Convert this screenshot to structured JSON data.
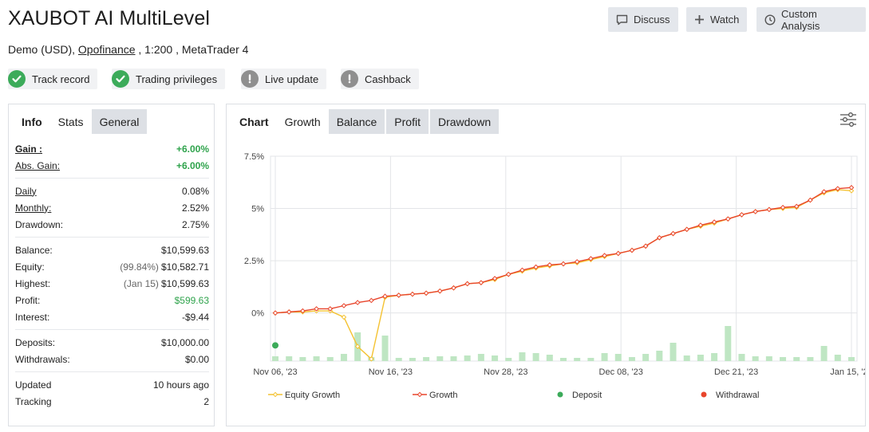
{
  "header": {
    "title": "XAUBOT AI MultiLevel",
    "account_type": "Demo (USD),",
    "broker": "Opofinance",
    "leverage": ", 1:200 , MetaTrader 4"
  },
  "actions": {
    "discuss": "Discuss",
    "watch": "Watch",
    "custom_analysis": "Custom Analysis"
  },
  "badges": [
    {
      "label": "Track record",
      "status": "verified"
    },
    {
      "label": "Trading privileges",
      "status": "verified"
    },
    {
      "label": "Live update",
      "status": "unverified"
    },
    {
      "label": "Cashback",
      "status": "unverified"
    }
  ],
  "left_tabs": {
    "info": "Info",
    "stats": "Stats",
    "general": "General"
  },
  "stats": {
    "gain": {
      "label": "Gain :",
      "value": "+6.00%"
    },
    "abs_gain": {
      "label": "Abs. Gain:",
      "value": "+6.00%"
    },
    "daily": {
      "label": "Daily",
      "value": "0.08%"
    },
    "monthly": {
      "label": "Monthly:",
      "value": "2.52%"
    },
    "drawdown": {
      "label": "Drawdown:",
      "value": "2.75%"
    },
    "balance": {
      "label": "Balance:",
      "value": "$10,599.63"
    },
    "equity": {
      "label": "Equity:",
      "prefix": "(99.84%)",
      "value": "$10,582.71"
    },
    "highest": {
      "label": "Highest:",
      "prefix": "(Jan 15)",
      "value": "$10,599.63"
    },
    "profit": {
      "label": "Profit:",
      "value": "$599.63"
    },
    "interest": {
      "label": "Interest:",
      "value": "-$9.44"
    },
    "deposits": {
      "label": "Deposits:",
      "value": "$10,000.00"
    },
    "withdrawals": {
      "label": "Withdrawals:",
      "value": "$0.00"
    },
    "updated": {
      "label": "Updated",
      "value": "10 hours ago"
    },
    "tracking": {
      "label": "Tracking",
      "value": "2"
    }
  },
  "chart_tabs": {
    "chart": "Chart",
    "growth": "Growth",
    "balance": "Balance",
    "profit": "Profit",
    "drawdown": "Drawdown"
  },
  "colors": {
    "growth": "#e8452c",
    "equity": "#f4c232",
    "deposit": "#3cab5a",
    "withdrawal": "#e8452c",
    "bars": "#bfe6c3",
    "badge_ok": "#3cab5a",
    "badge_warn": "#8f8f8f"
  },
  "chart_data": {
    "type": "line",
    "ylim": [
      -2.3,
      7.5
    ],
    "yticks": [
      {
        "v": 0,
        "label": "0%"
      },
      {
        "v": 2.5,
        "label": "2.5%"
      },
      {
        "v": 5,
        "label": "5%"
      },
      {
        "v": 7.5,
        "label": "7.5%"
      }
    ],
    "xlim": [
      0,
      40
    ],
    "xticks": [
      {
        "v": 0,
        "label": "Nov 06, '23"
      },
      {
        "v": 8,
        "label": "Nov 16, '23"
      },
      {
        "v": 16,
        "label": "Nov 28, '23"
      },
      {
        "v": 24,
        "label": "Dec 08, '23"
      },
      {
        "v": 32,
        "label": "Dec 21, '23"
      },
      {
        "v": 40,
        "label": "Jan 15, '24"
      }
    ],
    "legend": [
      "Equity Growth",
      "Growth",
      "Deposit",
      "Withdrawal"
    ],
    "legend_position": "bottom",
    "series": [
      {
        "name": "Growth",
        "values": [
          0.0,
          0.05,
          0.1,
          0.2,
          0.2,
          0.35,
          0.5,
          0.6,
          0.8,
          0.85,
          0.9,
          0.95,
          1.05,
          1.2,
          1.4,
          1.45,
          1.65,
          1.85,
          2.05,
          2.2,
          2.3,
          2.35,
          2.45,
          2.6,
          2.75,
          2.85,
          3.0,
          3.2,
          3.6,
          3.8,
          4.0,
          4.2,
          4.35,
          4.5,
          4.7,
          4.85,
          4.95,
          5.05,
          5.1,
          5.4,
          5.8,
          5.95,
          6.0
        ]
      },
      {
        "name": "Equity Growth",
        "values": [
          0.0,
          0.05,
          0.05,
          0.1,
          0.1,
          -0.2,
          -1.6,
          -2.2,
          0.75,
          0.85,
          0.9,
          0.95,
          1.05,
          1.2,
          1.4,
          1.45,
          1.6,
          1.85,
          2.0,
          2.15,
          2.25,
          2.35,
          2.4,
          2.55,
          2.7,
          2.85,
          3.0,
          3.2,
          3.6,
          3.8,
          4.0,
          4.15,
          4.3,
          4.5,
          4.7,
          4.85,
          4.95,
          5.0,
          5.05,
          5.4,
          5.75,
          5.9,
          5.85
        ]
      }
    ],
    "activity_bars": [
      0.6,
      0.6,
      0.5,
      0.6,
      0.5,
      0.9,
      3.6,
      0.5,
      3.2,
      0.4,
      0.4,
      0.5,
      0.6,
      0.6,
      0.7,
      0.9,
      0.7,
      0.4,
      1.1,
      1.0,
      0.8,
      0.4,
      0.4,
      0.4,
      1.0,
      0.9,
      0.5,
      0.9,
      1.3,
      2.3,
      0.7,
      0.8,
      1.0,
      4.4,
      0.9,
      0.6,
      0.6,
      0.5,
      0.5,
      0.5,
      1.9,
      0.8,
      0.5
    ],
    "deposits": [
      {
        "x": 0,
        "y": -1.55
      }
    ],
    "withdrawals": []
  }
}
